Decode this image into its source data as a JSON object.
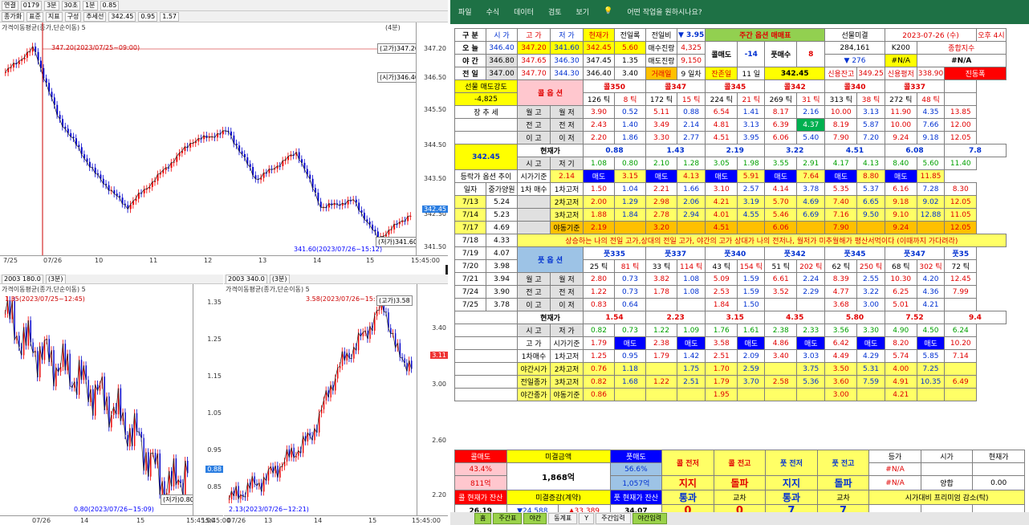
{
  "left": {
    "toolbar1": [
      "연결",
      "0179",
      "3분",
      "30초",
      "1분",
      "0.85"
    ],
    "toolbar2": [
      "종가화",
      "표준",
      "지표",
      "구성",
      "추세선",
      "342.45",
      "0.95",
      "1.57"
    ],
    "top_pane": {
      "title": "가격이동평균(종가,단순이동) 5",
      "status": "(4분)",
      "prices": [
        "347.20",
        "346.50",
        "345.50",
        "344.50",
        "343.50",
        "342.50",
        "341.50"
      ],
      "tags": {
        "high": "(고가)347.20",
        "low": "(저가)341.60",
        "mid": "(시가)346.40",
        "hline": "347.20(2023/07/25~09:00)",
        "bottom": "341.60(2023/07/26~15:12)"
      },
      "xlabels": [
        "7/25",
        "07/26",
        "10",
        "11",
        "12",
        "13",
        "14",
        "15",
        "15:45:00"
      ],
      "last": "342.45"
    },
    "bl_pane": {
      "title": "가격이동평균(종가,단순이동) 5",
      "code": "2003 180.0",
      "status": "(3분)",
      "prices": [
        "1.35",
        "1.25",
        "1.15",
        "1.05",
        "0.95",
        "0.85"
      ],
      "tags": {
        "top": "1.35(2023/07/25~12:45)",
        "low": "(저가)0.80",
        "bottom": "0.80(2023/07/26~15:09)"
      },
      "xlabels": [
        "07/26",
        "14",
        "15",
        "15:45:00"
      ],
      "last": "0.88"
    },
    "br_pane": {
      "title": "가격이동평균(종가,단순이동) 5",
      "code": "2003 340.0",
      "status": "(3분)",
      "prices": [
        "3.40",
        "3.00",
        "2.60",
        "2.20"
      ],
      "tags": {
        "top": "3.58(2023/07/26~15:12)",
        "high": "(고가)3.58",
        "bottom": "2.13(2023/07/26~12:21)"
      },
      "xlabels": [
        "15:45:00",
        "07/26",
        "13",
        "14",
        "15",
        "15:45:00"
      ],
      "last": "3.11"
    }
  },
  "ribbon": [
    "파일",
    "수식",
    "데이터",
    "검토",
    "보기",
    "어떤 작업을 원하시나요?"
  ],
  "sheet": {
    "r1": [
      "구 분",
      "시 가",
      "고 가",
      "저 가",
      "현재가",
      "전일록",
      "전일비",
      "▼ 3.95",
      "주간 옵션 매매표",
      "선물미결",
      "2023-07-26 (수)",
      "오후 4시"
    ],
    "r2": [
      "오 늘",
      "346.40",
      "347.20",
      "341.60",
      "342.45",
      "5.60",
      "매수진랑",
      "4,325",
      "콜매도",
      "-14",
      "풋매수",
      "8",
      "284,161",
      "K200",
      "종합지수"
    ],
    "r3": [
      "야 간",
      "346.80",
      "347.65",
      "346.30",
      "347.45",
      "1.35",
      "매도진랑",
      "9,150",
      "▼ 276",
      "#N/A",
      "#N/A"
    ],
    "r4": [
      "전 일",
      "347.00",
      "347.70",
      "344.30",
      "346.40",
      "3.40",
      "거래일",
      "9 일차",
      "잔존일",
      "11 일",
      "342.45",
      "신용잔고",
      "349.25",
      "신용평저",
      "338.90",
      "진동폭"
    ],
    "call": {
      "label": "콜 옵 션",
      "strikes": [
        "콜350",
        "콜347",
        "콜345",
        "콜342",
        "콜340",
        "콜337"
      ],
      "ticks": [
        [
          "126 틱",
          "8 틱"
        ],
        [
          "172 틱",
          "15 틱"
        ],
        [
          "224 틱",
          "21 틱"
        ],
        [
          "269 틱",
          "31 틱"
        ],
        [
          "313 틱",
          "38 틱"
        ],
        [
          "272 틱",
          "48 틱"
        ]
      ],
      "rows": [
        [
          "월 고",
          "월 저",
          "3.90",
          "0.52",
          "5.11",
          "0.88",
          "6.54",
          "1.41",
          "8.17",
          "2.16",
          "10.00",
          "3.13",
          "11.90",
          "4.35",
          "13.85"
        ],
        [
          "전 고",
          "전 저",
          "2.43",
          "1.40",
          "3.49",
          "2.14",
          "4.81",
          "3.13",
          "6.39",
          "4.37",
          "8.19",
          "5.87",
          "10.00",
          "7.66",
          "12.00"
        ],
        [
          "이 고",
          "이 저",
          "2.20",
          "1.86",
          "3.30",
          "2.77",
          "4.51",
          "3.95",
          "6.06",
          "5.40",
          "7.90",
          "7.20",
          "9.24",
          "9.18",
          "12.05"
        ]
      ],
      "cur": [
        "현재가",
        "0.88",
        "1.43",
        "2.19",
        "3.22",
        "4.51",
        "6.08",
        "7.8"
      ],
      "sg": [
        "시 고",
        "저 기",
        "1.08",
        "0.80",
        "2.10",
        "1.28",
        "3.05",
        "1.98",
        "3.55",
        "2.91",
        "4.17",
        "4.13",
        "8.40",
        "5.60",
        "11.40"
      ]
    },
    "left_labels": {
      "sell": "선물 매도강도",
      "sellv": "-4,825",
      "trend": "장 추 세",
      "price": "342.45",
      "l1": "등락가 옵션 추이",
      "l2": "일자",
      "l3": "중가양원",
      "l4": "1차 매수",
      "l5": "1차고저"
    },
    "dates": [
      [
        "7/13",
        "5.24"
      ],
      [
        "7/14",
        "5.23"
      ],
      [
        "7/17",
        "4.69"
      ],
      [
        "7/18",
        "4.33"
      ],
      [
        "7/19",
        "4.07"
      ],
      [
        "7/20",
        "3.98"
      ],
      [
        "7/21",
        "3.94"
      ],
      [
        "7/24",
        "3.90"
      ],
      [
        "7/25",
        "3.78"
      ]
    ],
    "crow": [
      [
        "시가기준",
        "2.14",
        "매도",
        "3.15",
        "매도",
        "4.13",
        "매도",
        "5.91",
        "매도",
        "7.64",
        "매도",
        "8.80",
        "매도",
        "11.85"
      ],
      [
        "1차고저",
        "1.50",
        "1.04",
        "2.21",
        "1.66",
        "3.10",
        "2.57",
        "4.14",
        "3.78",
        "5.35",
        "5.37",
        "6.16",
        "7.28",
        "8.30"
      ],
      [
        "2차고저",
        "2.00",
        "1.29",
        "2.98",
        "2.06",
        "4.21",
        "3.19",
        "5.70",
        "4.69",
        "7.40",
        "6.65",
        "9.18",
        "9.02",
        "12.05"
      ],
      [
        "3차고저",
        "1.88",
        "1.84",
        "2.78",
        "2.94",
        "4.01",
        "4.55",
        "5.46",
        "6.69",
        "7.16",
        "9.50",
        "9.10",
        "12.88",
        "11.05"
      ],
      [
        "야동기준",
        "2.19",
        "",
        "3.20",
        "",
        "4.51",
        "",
        "6.06",
        "",
        "7.90",
        "",
        "9.24",
        "",
        "12.05"
      ]
    ],
    "notice": "상승하는 나의 전일 고가,상대의 전일 고가, 야간의 고가 상대가 나의 전저나, 월저가 미추월해가 평산서먹이다 (이때까지 가다려라)",
    "put": {
      "label": "풋 옵 션",
      "strikes": [
        "풋335",
        "풋337",
        "풋340",
        "풋342",
        "풋345",
        "풋347",
        "풋35"
      ],
      "ticks": [
        [
          "25 틱",
          "81 틱"
        ],
        [
          "33 틱",
          "114 틱"
        ],
        [
          "43 틱",
          "154 틱"
        ],
        [
          "51 틱",
          "202 틱"
        ],
        [
          "62 틱",
          "250 틱"
        ],
        [
          "68 틱",
          "302 틱"
        ],
        [
          "72 틱",
          ""
        ]
      ],
      "rows": [
        [
          "월 고",
          "월 저",
          "2.80",
          "0.73",
          "3.82",
          "1.08",
          "5.09",
          "1.59",
          "6.61",
          "2.24",
          "8.39",
          "2.55",
          "10.30",
          "4.20",
          "12.45"
        ],
        [
          "전 고",
          "전 저",
          "1.22",
          "0.73",
          "1.78",
          "1.08",
          "2.53",
          "1.59",
          "3.52",
          "2.29",
          "4.77",
          "3.22",
          "6.25",
          "4.36",
          "7.99"
        ],
        [
          "이 고",
          "이 저",
          "0.83",
          "0.64",
          "",
          "",
          "1.84",
          "1.50",
          "",
          "",
          "3.68",
          "3.00",
          "5.01",
          "4.21",
          ""
        ]
      ],
      "cur": [
        "현재가",
        "1.54",
        "2.23",
        "3.15",
        "4.35",
        "5.80",
        "7.52",
        "9.4"
      ],
      "sg": [
        "시 고",
        "저 가",
        "0.82",
        "0.73",
        "1.22",
        "1.09",
        "1.76",
        "1.61",
        "2.38",
        "2.33",
        "3.56",
        "3.30",
        "4.90",
        "4.50",
        "6.24"
      ],
      "prow": [
        [
          "고 가",
          "시가기준",
          "1.79",
          "매도",
          "2.38",
          "매도",
          "3.58",
          "매도",
          "4.86",
          "매도",
          "6.42",
          "매도",
          "8.20",
          "매도",
          "10.20"
        ],
        [
          "1차매수",
          "1차고저",
          "1.25",
          "0.95",
          "1.79",
          "1.42",
          "2.51",
          "2.09",
          "3.40",
          "3.03",
          "4.49",
          "4.29",
          "5.74",
          "5.85",
          "7.14"
        ],
        [
          "야간시가",
          "2차고저",
          "0.76",
          "1.18",
          "",
          "1.75",
          "1.70",
          "2.59",
          "",
          "3.75",
          "3.50",
          "5.31",
          "4.00",
          "7.25",
          ""
        ],
        [
          "전일종가",
          "3차고저",
          "0.82",
          "1.68",
          "1.22",
          "2.51",
          "1.79",
          "3.70",
          "2.58",
          "5.36",
          "3.60",
          "7.59",
          "4.91",
          "10.35",
          "6.49"
        ],
        [
          "야간종가",
          "야동기준",
          "0.86",
          "",
          "",
          "",
          "1.95",
          "",
          "",
          "",
          "3.00",
          "",
          "4.21",
          "",
          ""
        ]
      ]
    }
  },
  "bottom": {
    "c1h": "콜매도",
    "c2h": "미결금액",
    "c3h": "풋매도",
    "pct1": "43.4%",
    "pct2": "56.6%",
    "amt1": "811억",
    "amt2": "1,868억",
    "amt3": "1,057억",
    "callcnt": "콜 전저",
    "callhigh": "콜 전고",
    "putcnt": "풋 전저",
    "puthigh": "풋 전고",
    "g1": "등가",
    "g2": "시가",
    "g3": "현재가",
    "jiji": "지지",
    "dolpa": "돌파",
    "tonggwa": "통과",
    "cross": "교차",
    "v": [
      "0",
      "0",
      "7",
      "7",
      "7",
      "0",
      "0",
      "0"
    ],
    "na": [
      "#N/A",
      "#N/A"
    ],
    "yh": "양합",
    "yv": "0.00",
    "cw": "콜 현재가 잔산",
    "cwv": "26.19",
    "mg": "미결증감(계약)",
    "mg1": "▼24,588",
    "mg2": "▲33,389",
    "pw": "풋 현재가 잔산",
    "pwv": "34.07",
    "pm": "시가대비 프리미엄 감소(탁)"
  },
  "tabs": [
    "홈",
    "주간표",
    "야간",
    "동계표",
    "Y",
    "주간입력",
    "야간입력"
  ]
}
